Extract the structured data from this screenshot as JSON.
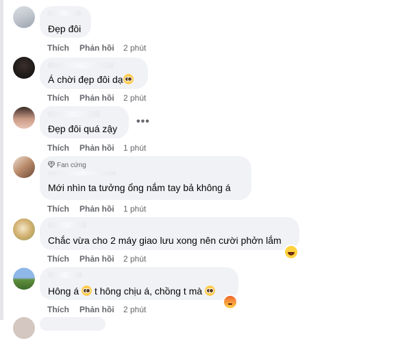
{
  "comments": [
    {
      "text": "Đẹp đôi",
      "badge": "",
      "time": "2 phút",
      "reactions": []
    },
    {
      "text": "Á chời đẹp đôi dạ",
      "badge": "",
      "time": "2 phút",
      "reactions": [],
      "name_fragment": "Nguyễn  Vn  Nh"
    },
    {
      "text": "Đẹp đôi quá zậy",
      "badge": "",
      "time": "1 phút",
      "reactions": [],
      "more_menu": "•••"
    },
    {
      "text": "Mới nhìn ta tưởng ổng nắm tay bả không á",
      "badge": "Fan cứng",
      "time": "1 phút",
      "reactions": []
    },
    {
      "text": "Chắc vừa cho 2 máy giao lưu xong nên cười phởn lắm",
      "badge": "",
      "time": "2 phút",
      "reactions": [
        "haha-reaction"
      ]
    },
    {
      "text_part1": "Hông á",
      "text_part2": "t hông chịu á, chồng t mà",
      "badge": "",
      "time": "2 phút",
      "reactions": [
        "angry-reaction"
      ]
    }
  ],
  "actions": {
    "like": "Thích",
    "reply": "Phản hồi"
  },
  "colors": {
    "bubble": "#f0f2f5",
    "secondary_text": "#65676b",
    "primary_text": "#050505"
  },
  "icons": [
    "pleading-face-emoji",
    "diamond-icon",
    "more-dots-icon",
    "haha-reaction",
    "angry-reaction"
  ]
}
